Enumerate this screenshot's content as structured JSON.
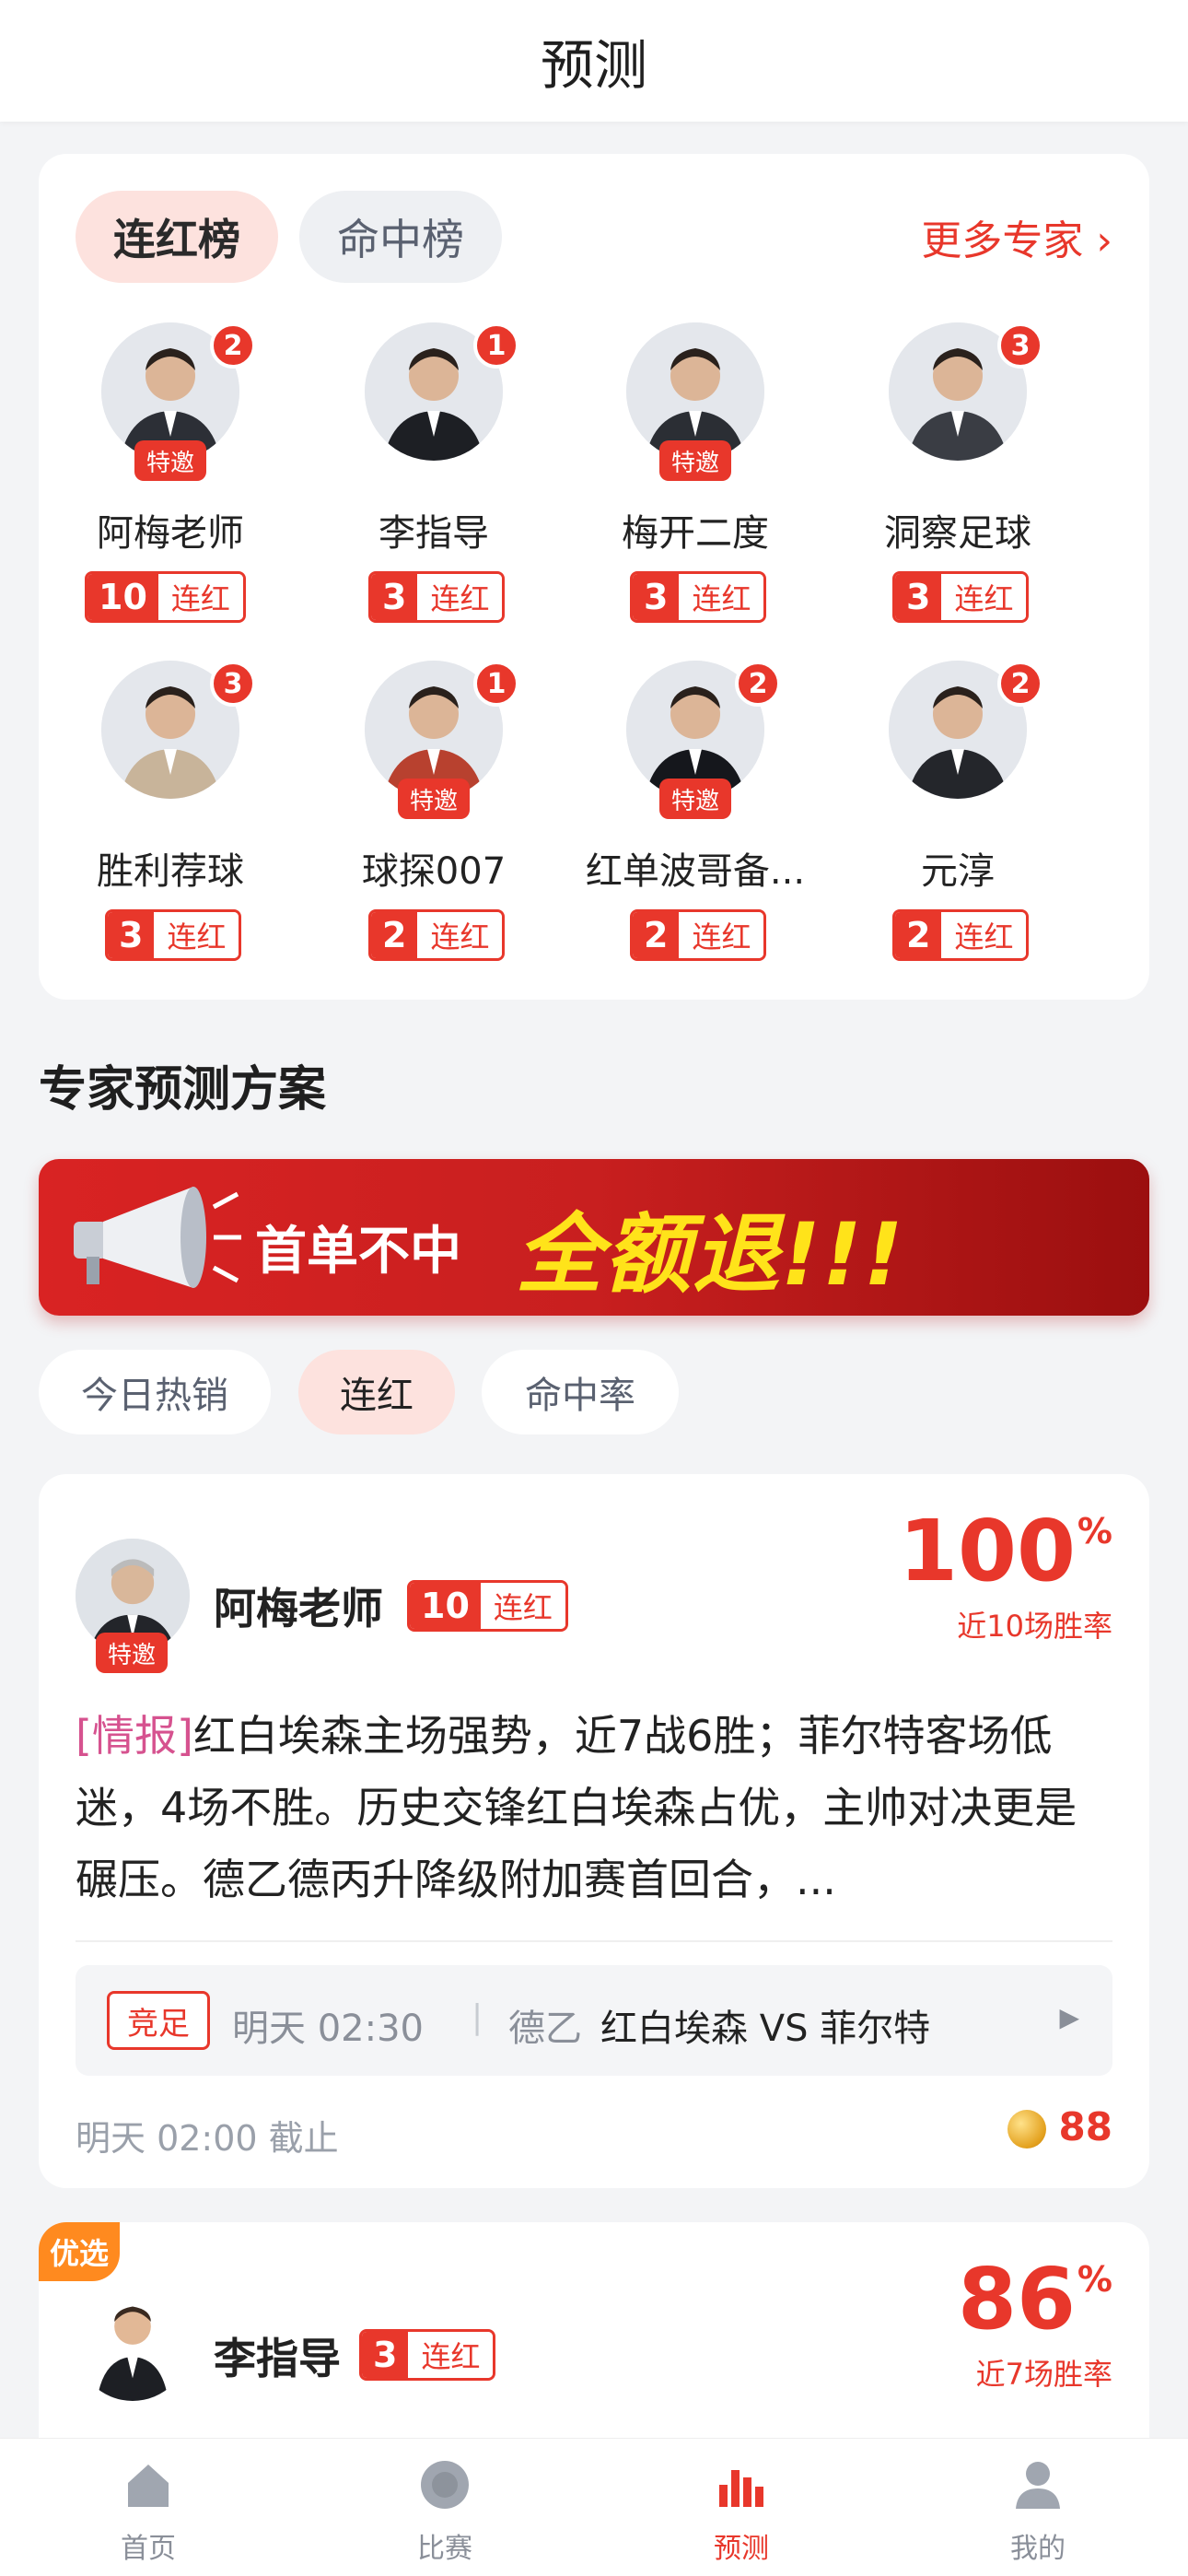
{
  "header": {
    "title": "预测"
  },
  "ranking": {
    "tabs": [
      "连红榜",
      "命中榜"
    ],
    "more_label": "更多专家 ›",
    "experts": [
      {
        "name": "阿梅老师",
        "rank": "2",
        "invited": true,
        "streak": "10",
        "streak_label": "连红"
      },
      {
        "name": "李指导",
        "rank": "1",
        "invited": false,
        "streak": "3",
        "streak_label": "连红"
      },
      {
        "name": "梅开二度",
        "rank": "",
        "invited": true,
        "streak": "3",
        "streak_label": "连红"
      },
      {
        "name": "洞察足球",
        "rank": "3",
        "invited": false,
        "streak": "3",
        "streak_label": "连红"
      },
      {
        "name": "胜利荐球",
        "rank": "3",
        "invited": false,
        "streak": "3",
        "streak_label": "连红"
      },
      {
        "name": "球探007",
        "rank": "1",
        "invited": true,
        "streak": "2",
        "streak_label": "连红"
      },
      {
        "name": "红单波哥备...",
        "rank": "2",
        "invited": true,
        "streak": "2",
        "streak_label": "连红"
      },
      {
        "name": "元淳",
        "rank": "2",
        "invited": false,
        "streak": "2",
        "streak_label": "连红"
      }
    ],
    "invite_label": "特邀"
  },
  "section_title": "专家预测方案",
  "banner": {
    "text": "首单不中",
    "highlight": "全额退!!!"
  },
  "filters": [
    "今日热销",
    "连红",
    "命中率"
  ],
  "plan": {
    "expert": "阿梅老师",
    "invite_label": "特邀",
    "streak": "10",
    "streak_label": "连红",
    "rate": "100",
    "rate_unit": "%",
    "rate_label": "近10场胜率",
    "tag": "[情报]",
    "content": "红白埃森主场强势，近7战6胜；菲尔特客场低迷，4场不胜。历史交锋红白埃森占优，主帅对决更是碾压。德乙德丙升降级附加赛首回合，...",
    "match_type": "竞足",
    "match_time": "明天 02:30",
    "league": "德乙",
    "teams": "红白埃森 VS 菲尔特",
    "deadline": "明天 02:00 截止",
    "price": "88"
  },
  "plan2": {
    "pick_label": "优选",
    "expert": "李指导",
    "streak": "3",
    "streak_label": "连红",
    "rate": "86",
    "rate_unit": "%",
    "rate_label": "近7场胜率"
  },
  "tabbar": [
    {
      "label": "首页",
      "icon": "home-icon"
    },
    {
      "label": "比赛",
      "icon": "match-icon"
    },
    {
      "label": "预测",
      "icon": "chart-icon",
      "active": true
    },
    {
      "label": "我的",
      "icon": "profile-icon"
    }
  ],
  "colors": {
    "accent": "#e8372b",
    "banner_text": "#ffe31a",
    "tag_pink": "#d6528f",
    "pick_orange": "#ff8a1f"
  }
}
